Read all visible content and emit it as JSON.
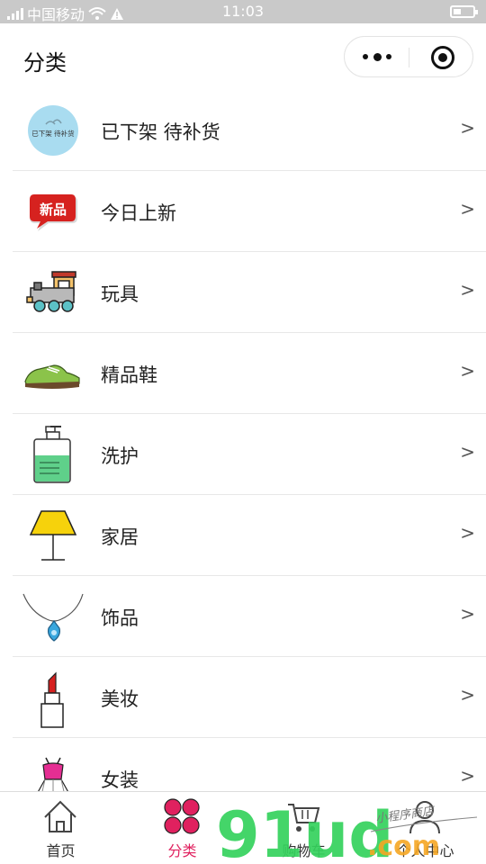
{
  "status_bar": {
    "carrier": "中国移动",
    "time": "11:03"
  },
  "nav": {
    "title": "分类"
  },
  "categories": [
    {
      "label": "已下架 待补货",
      "icon": "restock-badge-icon",
      "badge_text": "已下架 待补货",
      "arrow": ">"
    },
    {
      "label": "今日上新",
      "icon": "new-badge-icon",
      "badge_text": "新品",
      "arrow": ">"
    },
    {
      "label": "玩具",
      "icon": "toy-train-icon",
      "arrow": ">"
    },
    {
      "label": "精品鞋",
      "icon": "sneaker-icon",
      "arrow": ">"
    },
    {
      "label": "洗护",
      "icon": "lotion-bottle-icon",
      "arrow": ">"
    },
    {
      "label": "家居",
      "icon": "lamp-icon",
      "arrow": ">"
    },
    {
      "label": "饰品",
      "icon": "necklace-icon",
      "arrow": ">"
    },
    {
      "label": "美妆",
      "icon": "lipstick-icon",
      "arrow": ">"
    },
    {
      "label": "女装",
      "icon": "dress-icon",
      "arrow": ">"
    }
  ],
  "tabbar": [
    {
      "label": "首页",
      "icon": "home-icon",
      "active": false
    },
    {
      "label": "分类",
      "icon": "category-flower-icon",
      "active": true
    },
    {
      "label": "购物车",
      "icon": "cart-icon",
      "active": false
    },
    {
      "label": "个人中心",
      "icon": "user-icon",
      "active": false
    }
  ],
  "watermark": {
    "brand": "91ud",
    "suffix": ".com",
    "handwriting": "小程序商店"
  },
  "colors": {
    "accent": "#e0215f",
    "watermark_green": "#34d15c",
    "watermark_orange": "#f5a623"
  }
}
